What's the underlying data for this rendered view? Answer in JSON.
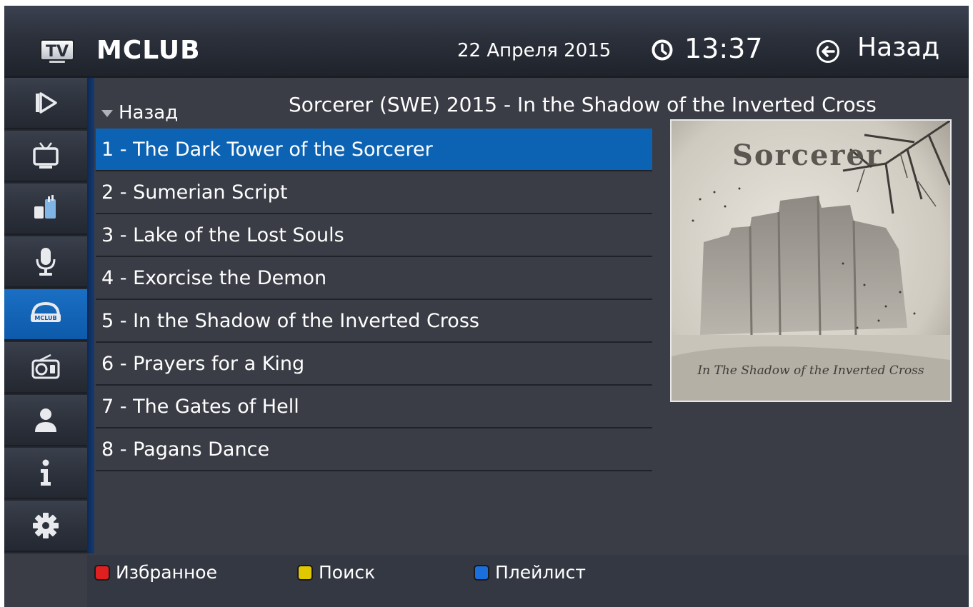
{
  "header": {
    "logo_text": "TV",
    "title": "MCLUB",
    "date": "22 Апреля 2015",
    "time": "13:37",
    "back_label": "Назад"
  },
  "sidebar": {
    "items": [
      {
        "icon": "play-icon",
        "active": false
      },
      {
        "icon": "tv-icon",
        "active": false
      },
      {
        "icon": "cinema-icon",
        "active": false
      },
      {
        "icon": "microphone-icon",
        "active": false
      },
      {
        "icon": "mclub-icon",
        "label": "MCLUB",
        "active": true
      },
      {
        "icon": "radio-icon",
        "active": false
      },
      {
        "icon": "user-icon",
        "active": false
      },
      {
        "icon": "info-icon",
        "active": false
      },
      {
        "icon": "gear-icon",
        "active": false
      }
    ]
  },
  "content": {
    "back_label": "Назад",
    "album_title": "Sorcerer (SWE) 2015 - In the Shadow of the Inverted Cross",
    "tracks": [
      "1 - The Dark Tower of the Sorcerer",
      "2 - Sumerian Script",
      "3 - Lake of the Lost Souls",
      "4 - Exorcise the Demon",
      "5 - In the Shadow of the Inverted Cross",
      "6 - Prayers for a King",
      "7 - The Gates of Hell",
      "8 - Pagans Dance"
    ],
    "selected_track": 0,
    "album_art": {
      "band_logo_text": "Sorcerer",
      "subtitle_script": "In The Shadow of the Inverted Cross"
    }
  },
  "footer": {
    "hints": [
      {
        "color": "#e02020",
        "label": "Избранное"
      },
      {
        "color": "#e0c800",
        "label": "Поиск"
      },
      {
        "color": "#1a6fdc",
        "label": "Плейлист"
      }
    ]
  },
  "colors": {
    "accent": "#0c63b4",
    "background": "#3a3d46",
    "sidebar": "#2c313b"
  }
}
